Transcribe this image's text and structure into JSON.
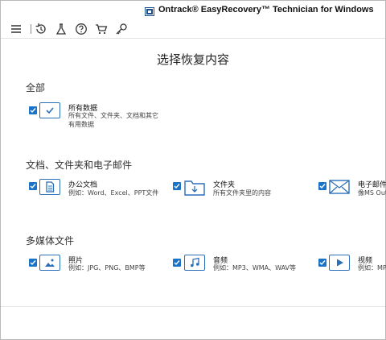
{
  "window": {
    "title": "Ontrack® EasyRecovery™ Technician for Windows"
  },
  "toolbar": {
    "icons": [
      "menu-icon",
      "recovery-icon",
      "tools-icon",
      "help-icon",
      "cart-icon",
      "key-icon"
    ]
  },
  "main": {
    "heading": "选择恢复内容",
    "sections": [
      {
        "label": "全部",
        "items": [
          {
            "title": "所有数据",
            "desc": "所有文件、文件夹、文档和其它有用数据",
            "icon": "checkmark-icon",
            "checked": true
          }
        ]
      },
      {
        "label": "文档、文件夹和电子邮件",
        "items": [
          {
            "title": "办公文档",
            "desc": "例如：Word、Excel、PPT文件",
            "icon": "document-icon",
            "checked": true
          },
          {
            "title": "文件夹",
            "desc": "所有文件夹里的内容",
            "icon": "folder-icon",
            "checked": true
          },
          {
            "title": "电子邮件",
            "desc": "像MS Out",
            "icon": "envelope-icon",
            "checked": true
          }
        ]
      },
      {
        "label": "多媒体文件",
        "items": [
          {
            "title": "照片",
            "desc": "例如：JPG、PNG、BMP等",
            "icon": "image-icon",
            "checked": true
          },
          {
            "title": "音频",
            "desc": "例如：MP3、WMA、WAV等",
            "icon": "music-icon",
            "checked": true
          },
          {
            "title": "视频",
            "desc": "例如：MP",
            "icon": "video-icon",
            "checked": true
          }
        ]
      }
    ]
  },
  "colors": {
    "accent": "#1a73c6",
    "icon_border": "#2a6fb8"
  }
}
